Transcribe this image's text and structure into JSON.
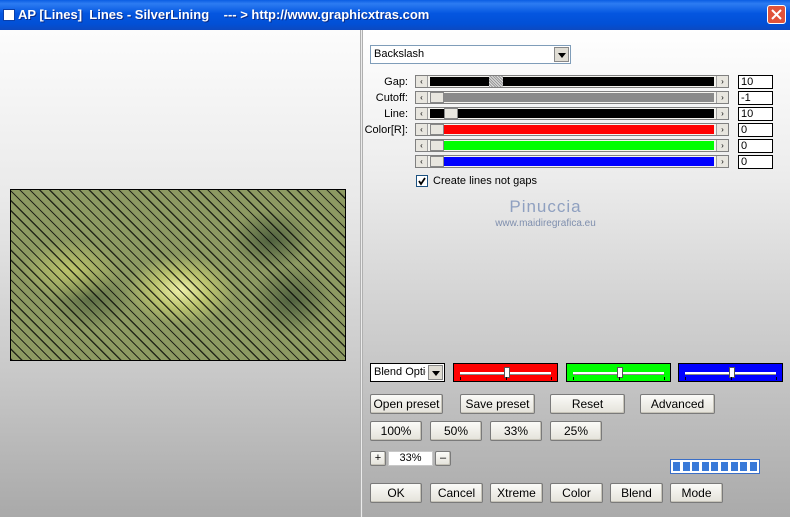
{
  "window": {
    "title": "AP [Lines]  Lines - SilverLining    --- > http://www.graphicxtras.com"
  },
  "pattern_select": {
    "value": "Backslash"
  },
  "sliders": [
    {
      "label": "Gap:",
      "value": "10",
      "color": "#000000",
      "level": 0.22
    },
    {
      "label": "Cutoff:",
      "value": "-1",
      "color": "#8a8a8a",
      "level": 0.0
    },
    {
      "label": "Line:",
      "value": "10",
      "color": "#000000",
      "level": 0.05
    },
    {
      "label": "Color[R]:",
      "value": "0",
      "color": "#ff0000",
      "level": 0.0
    },
    {
      "label": "",
      "value": "0",
      "color": "#00ff00",
      "level": 0.0
    },
    {
      "label": "",
      "value": "0",
      "color": "#0000ff",
      "level": 0.0
    }
  ],
  "checkbox": {
    "label": "Create lines not gaps",
    "checked": true
  },
  "watermark": {
    "line1": "Pinuccia",
    "line2": "www.maidiregrafica.eu"
  },
  "blend_select": {
    "value": "Blend Optio"
  },
  "color_sliders": [
    {
      "color": "#ff0000",
      "level": 0.5
    },
    {
      "color": "#00ff00",
      "level": 0.5
    },
    {
      "color": "#0000ff",
      "level": 0.5
    }
  ],
  "preset_buttons": {
    "open": "Open preset",
    "save": "Save preset",
    "reset": "Reset",
    "advanced": "Advanced"
  },
  "zoom_buttons": {
    "z100": "100%",
    "z50": "50%",
    "z33": "33%",
    "z25": "25%"
  },
  "zoom": {
    "plus": "+",
    "value": "33%",
    "minus": "–"
  },
  "progress": {
    "cells": 9,
    "filled": 9
  },
  "bottom_buttons": {
    "ok": "OK",
    "cancel": "Cancel",
    "xtreme": "Xtreme",
    "color": "Color",
    "blend": "Blend",
    "mode": "Mode"
  }
}
